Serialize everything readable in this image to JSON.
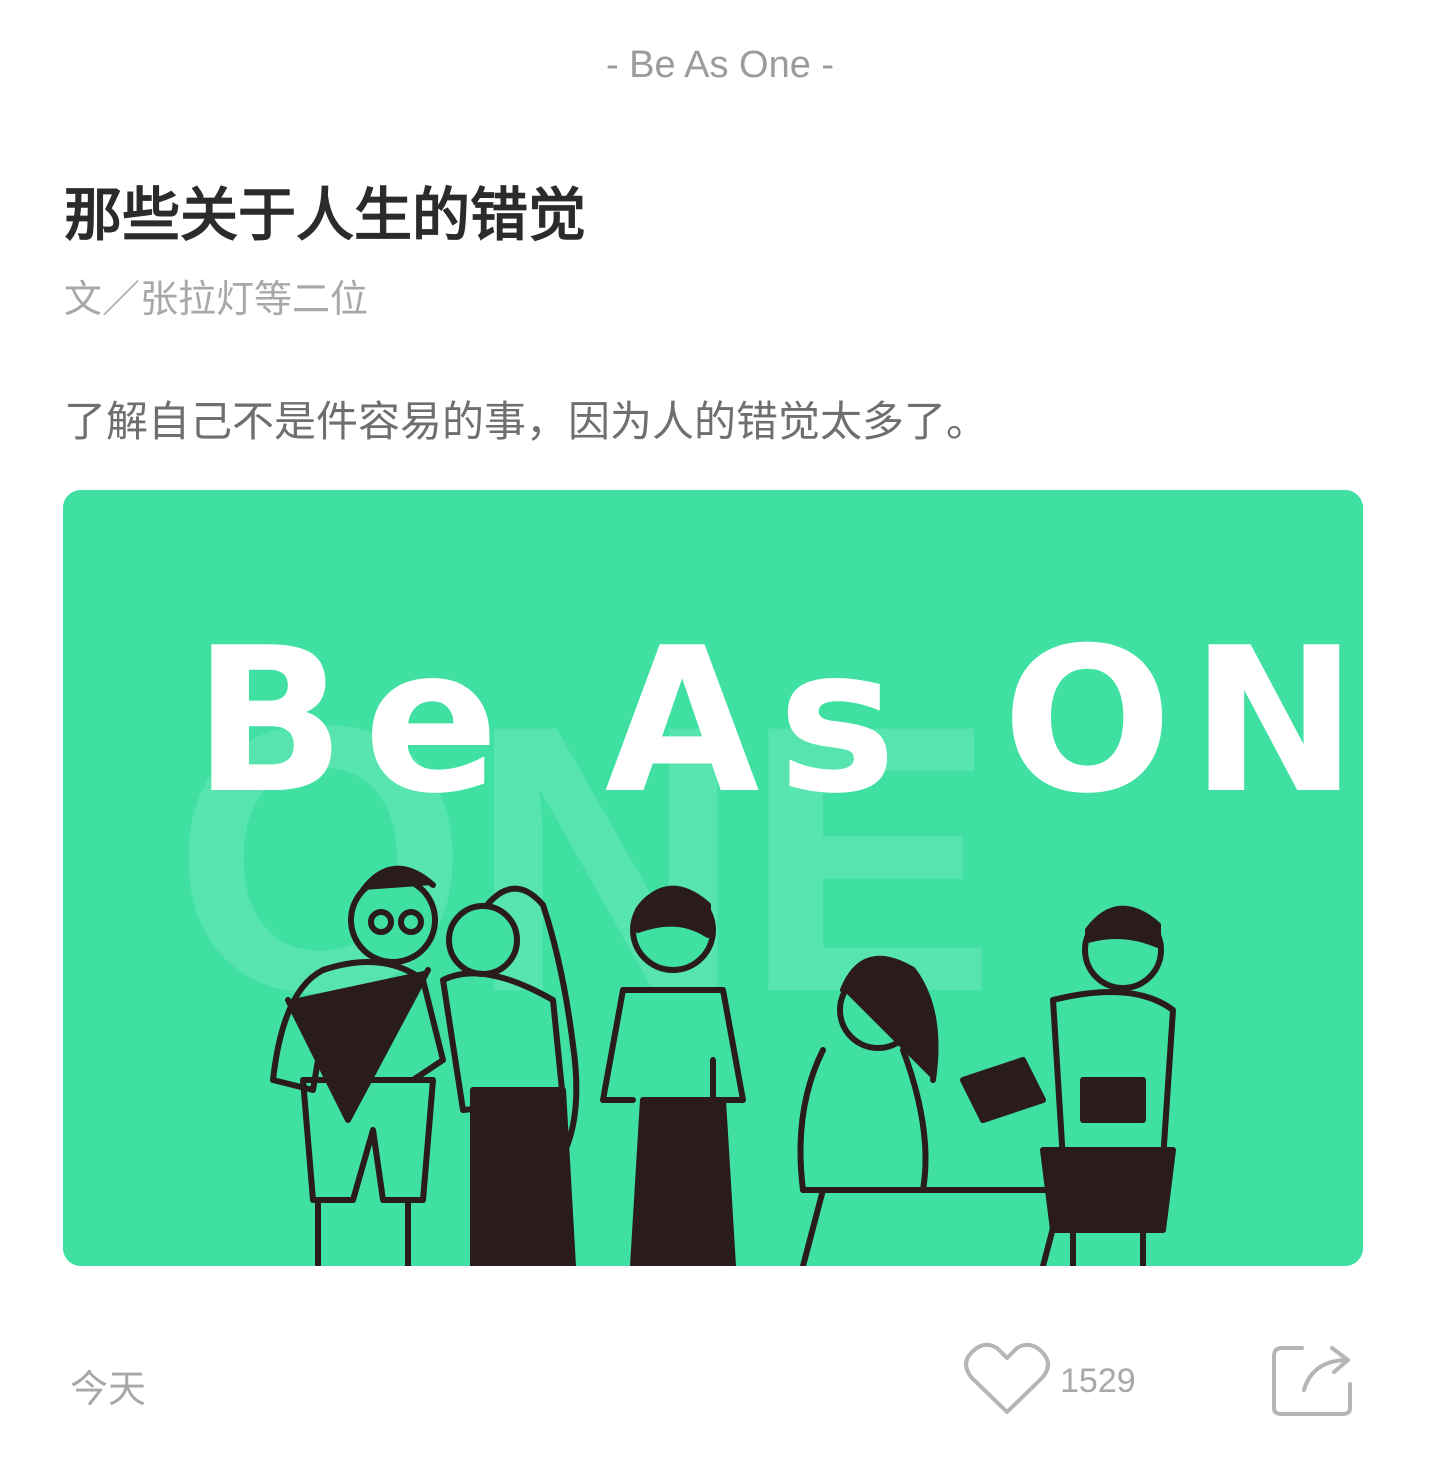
{
  "header": {
    "category": "- Be As One -"
  },
  "article": {
    "title": "那些关于人生的错觉",
    "author": "文／张拉灯等二位",
    "summary": "了解自己不是件容易的事，因为人的错觉太多了。",
    "cover": {
      "headline": "Be As ONE",
      "watermark": "ONE",
      "background_color": "#3fe0a2"
    }
  },
  "footer": {
    "date": "今天",
    "like_icon": "heart-icon",
    "like_count": "1529",
    "share_icon": "share-icon"
  },
  "colors": {
    "muted_text": "#a8a8a8",
    "title_text": "#2b2b2b",
    "illustration_ink": "#2a1c1a"
  }
}
